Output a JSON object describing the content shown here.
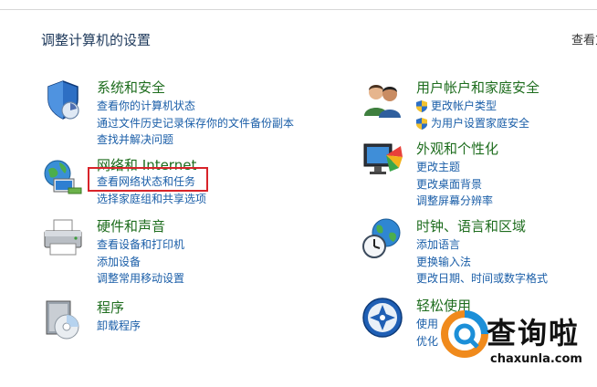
{
  "header": {
    "title": "调整计算机的设置",
    "view_by": "查看方"
  },
  "left": [
    {
      "heading": "系统和安全",
      "icon": "shield-icon",
      "links": [
        "查看你的计算机状态",
        "通过文件历史记录保存你的文件备份副本",
        "查找并解决问题"
      ]
    },
    {
      "heading": "网络和 Internet",
      "icon": "network-globe-icon",
      "links": [
        "查看网络状态和任务",
        "选择家庭组和共享选项"
      ]
    },
    {
      "heading": "硬件和声音",
      "icon": "printer-icon",
      "links": [
        "查看设备和打印机",
        "添加设备",
        "调整常用移动设置"
      ]
    },
    {
      "heading": "程序",
      "icon": "programs-disc-icon",
      "links": [
        "卸载程序"
      ]
    }
  ],
  "right": [
    {
      "heading": "用户帐户和家庭安全",
      "icon": "users-icon",
      "links": [
        "更改帐户类型",
        "为用户设置家庭安全"
      ]
    },
    {
      "heading": "外观和个性化",
      "icon": "monitor-palette-icon",
      "links": [
        "更改主题",
        "更改桌面背景",
        "调整屏幕分辨率"
      ]
    },
    {
      "heading": "时钟、语言和区域",
      "icon": "clock-globe-icon",
      "links": [
        "添加语言",
        "更换输入法",
        "更改日期、时间或数字格式"
      ]
    },
    {
      "heading": "轻松使用",
      "icon": "ease-of-access-icon",
      "links": [
        "使用",
        "优化"
      ]
    }
  ],
  "watermark": {
    "title": "查询啦",
    "subtitle": "chaxunla.com"
  },
  "colors": {
    "heading": "#1e6d1e",
    "link": "#1a5ea8",
    "highlight": "#d8232a"
  }
}
